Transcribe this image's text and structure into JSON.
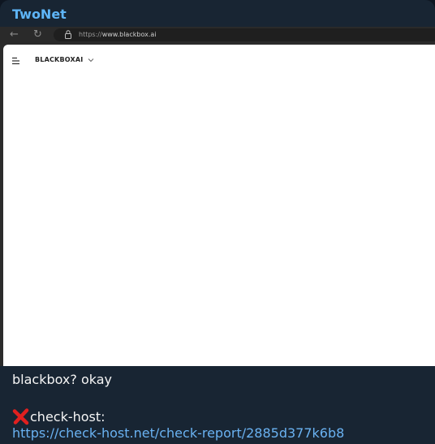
{
  "message": {
    "sender": "TwoNet",
    "text_line1": "blackbox? okay",
    "check_label": "check-host:",
    "link": "https://check-host.net/check-report/2885d377k6b8",
    "cross_icon": "red-cross-mark-icon"
  },
  "browser": {
    "url_scheme": "https://",
    "url_host": "www.blackbox.ai",
    "brand": "BLACKBOXAI",
    "icons": [
      "back-arrow-icon",
      "reload-icon",
      "lock-icon",
      "menu-icon",
      "chevron-down-icon"
    ]
  },
  "colors": {
    "sender": "#5eb5f7",
    "bubble": "#182533",
    "link": "#6ab2f2",
    "cross": "#e0201f"
  }
}
